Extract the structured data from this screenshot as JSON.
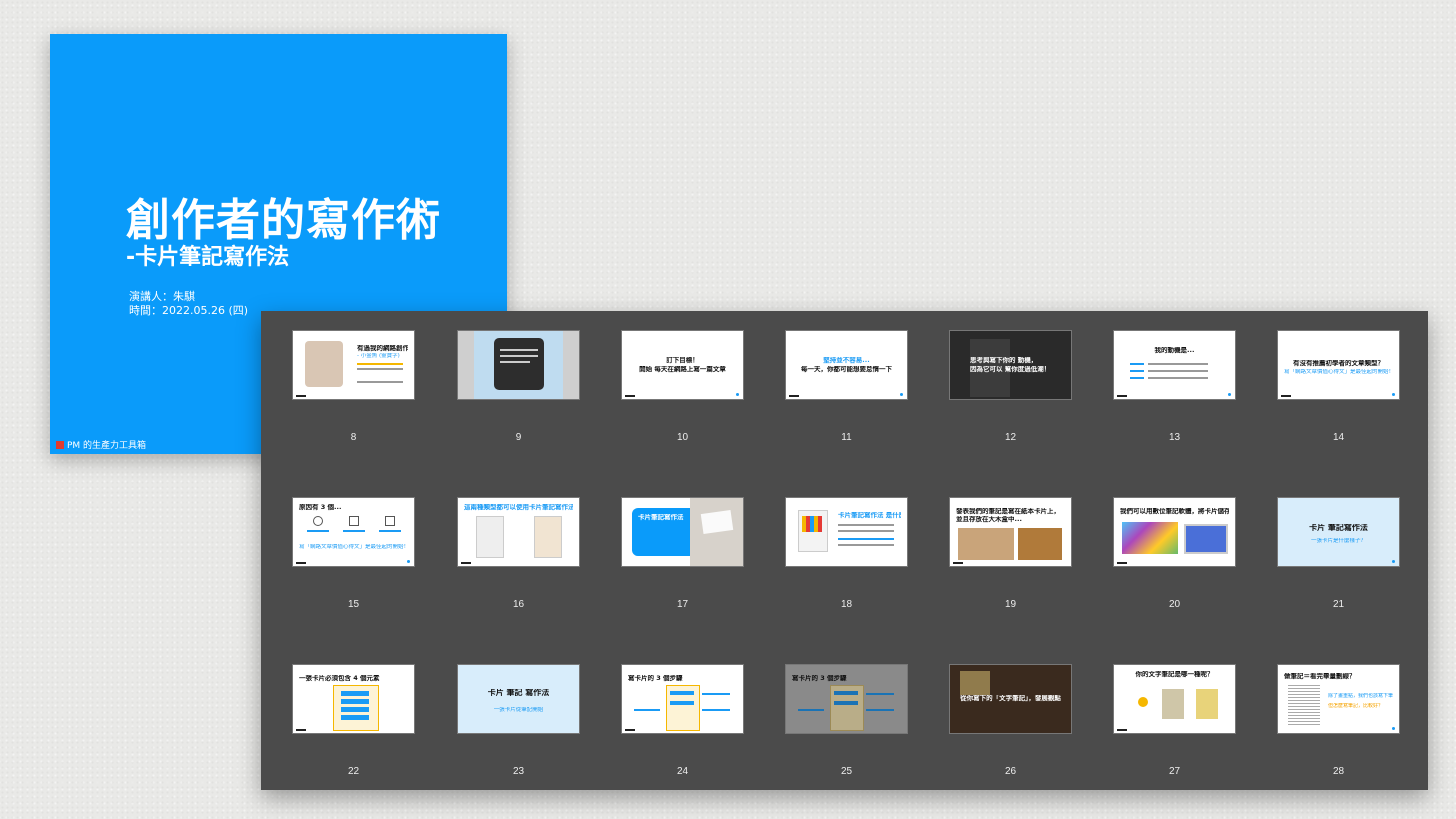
{
  "title_slide": {
    "title": "創作者的寫作術",
    "subtitle": "-卡片筆記寫作法",
    "speaker": "演講人：朱騏",
    "date": "時間：2022.05.26 (四)",
    "brand": "PM 的生產力工具箱"
  },
  "colors": {
    "accent_blue": "#0a9bfa",
    "sorter_bg": "#4b4b4b",
    "highlight_yellow": "#f5b700"
  },
  "slides": [
    {
      "num": "8",
      "lines": [
        "有過我的網路創作者",
        "- 小金魚 (靈寶字)"
      ]
    },
    {
      "num": "9",
      "lines": []
    },
    {
      "num": "10",
      "lines": [
        "訂下目標！",
        "開始 每天在網路上寫一篇文章"
      ]
    },
    {
      "num": "11",
      "lines": [
        "堅持並不容易...",
        "每一天，你都可能想要怠惰一下"
      ]
    },
    {
      "num": "12",
      "lines": [
        "思考與寫下你的 動機，",
        "因為它可以 幫你度過低潮！"
      ]
    },
    {
      "num": "13",
      "lines": [
        "我的動機是..."
      ]
    },
    {
      "num": "14",
      "lines": [
        "有沒有推薦初學者的文章類型？",
        "寫「網路文章價值心得文」是最佳起的開始！"
      ]
    },
    {
      "num": "15",
      "lines": [
        "原因有 3 個...",
        "寫「網路文章價值心得文」是最佳起的開始！"
      ]
    },
    {
      "num": "16",
      "lines": [
        "這兩種類型都可以使用卡片筆記寫作法！"
      ]
    },
    {
      "num": "17",
      "lines": [
        "卡片筆記寫作法"
      ]
    },
    {
      "num": "18",
      "lines": [
        "卡片筆記寫作法 是什麼？"
      ]
    },
    {
      "num": "19",
      "lines": [
        "發表我們的筆記是寫在紙本卡片上，",
        "並且存放在大木盒中..."
      ]
    },
    {
      "num": "20",
      "lines": [
        "我們可以用數位筆記軟體，將卡片儲存在電腦中！"
      ]
    },
    {
      "num": "21",
      "lines": [
        "卡片 筆記寫作法",
        "一張卡片是什麼樣子？"
      ]
    },
    {
      "num": "22",
      "lines": [
        "一張卡片必須包含 4 個元素"
      ]
    },
    {
      "num": "23",
      "lines": [
        "卡片 筆記 寫作法",
        "一張卡片從筆記開始"
      ]
    },
    {
      "num": "24",
      "lines": [
        "寫卡片的 3 個步驟"
      ]
    },
    {
      "num": "25",
      "lines": [
        "寫卡片的 3 個步驟"
      ]
    },
    {
      "num": "26",
      "lines": [
        "從你寫下的「文字筆記」，發展觀點"
      ]
    },
    {
      "num": "27",
      "lines": [
        "你的文字筆記是哪一種呢？"
      ]
    },
    {
      "num": "28",
      "lines": [
        "做筆記＝看完畢量劃線？",
        "除了畫重點，我們也該寫下筆記！",
        "但怎麼寫筆記，比較好？"
      ]
    }
  ]
}
